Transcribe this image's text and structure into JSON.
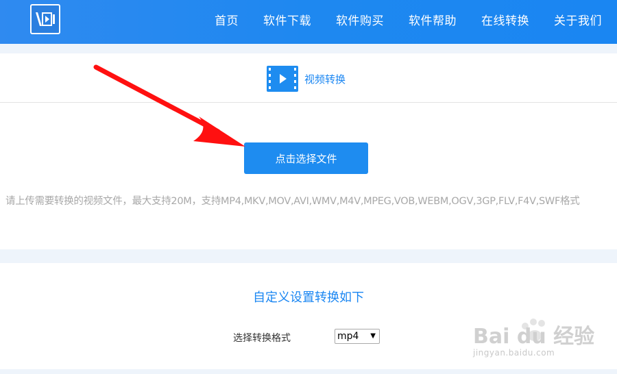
{
  "header": {
    "nav": [
      "首页",
      "软件下载",
      "软件购买",
      "软件帮助",
      "在线转换",
      "关于我们"
    ]
  },
  "upload_panel": {
    "title": "视频转换",
    "button_label": "点击选择文件",
    "hint": "请上传需要转换的视频文件，最大支持20M，支持MP4,MKV,MOV,AVI,WMV,M4V,MPEG,VOB,WEBM,OGV,3GP,FLV,F4V,SWF格式"
  },
  "settings_panel": {
    "title": "自定义设置转换如下",
    "format_label": "选择转换格式",
    "format_value": "mp4"
  },
  "watermark": {
    "brand": "Bai du 经验",
    "url": "jingyan.baidu.com"
  },
  "colors": {
    "accent": "#1e8cf0",
    "annotation_arrow": "#ff1010"
  }
}
